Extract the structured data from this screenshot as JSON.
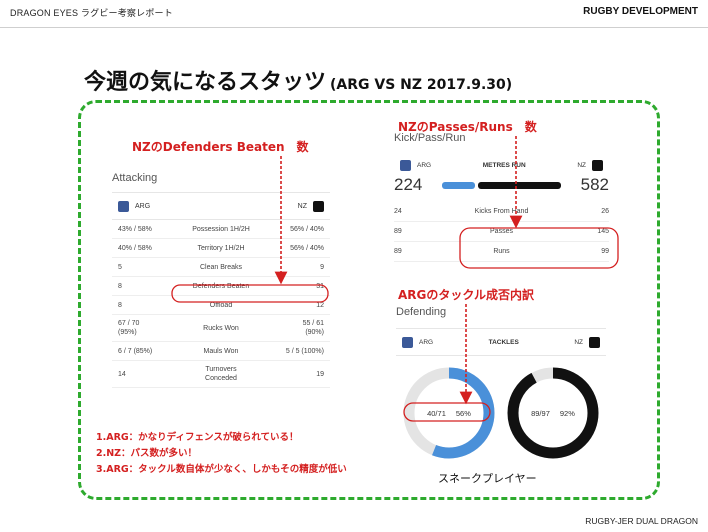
{
  "header": {
    "left": "DRAGON EYES ラグビー考察レポート",
    "right": "RUGBY DEVELOPMENT"
  },
  "footer": "RUGBY-JER DUAL DRAGON",
  "title": {
    "main": "今週の気になるスタッツ",
    "sub": "(ARG VS NZ 2017.9.30)"
  },
  "annotations": {
    "defenders_beaten": "NZのDefenders Beaten　数",
    "passes_runs": "NZのPasses/Runs　数",
    "arg_tackles": "ARGのタックル成否内訳"
  },
  "attacking": {
    "section": "Attacking",
    "team_left": "ARG",
    "team_right": "NZ",
    "rows": [
      {
        "l": "43% / 58%",
        "c": "Possession 1H/2H",
        "r": "56% / 40%"
      },
      {
        "l": "40% / 58%",
        "c": "Territory 1H/2H",
        "r": "56% / 40%"
      },
      {
        "l": "5",
        "c": "Clean Breaks",
        "r": "9"
      },
      {
        "l": "8",
        "c": "Defenders Beaten",
        "r": "31"
      },
      {
        "l": "8",
        "c": "Offload",
        "r": "12"
      },
      {
        "l": "67 / 70\n(95%)",
        "c": "Rucks Won",
        "r": "55 / 61\n(90%)"
      },
      {
        "l": "6 / 7 (85%)",
        "c": "Mauls Won",
        "r": "5 / 5 (100%)"
      },
      {
        "l": "14",
        "c": "Turnovers\nConceded",
        "r": "19"
      }
    ]
  },
  "kick_pass_run": {
    "section": "Kick/Pass/Run",
    "team_left": "ARG",
    "metric": "METRES RUN",
    "team_right": "NZ",
    "metres_left": "224",
    "metres_right": "582",
    "rows": [
      {
        "l": "24",
        "c": "Kicks From Hand",
        "r": "26"
      },
      {
        "l": "89",
        "c": "Passes",
        "r": "145"
      },
      {
        "l": "89",
        "c": "Runs",
        "r": "99"
      }
    ]
  },
  "defending": {
    "section": "Defending",
    "team_left": "ARG",
    "metric": "TACKLES",
    "team_right": "NZ",
    "arg_tackles": "40/71",
    "arg_pct": "56%",
    "arg_fraction": 0.56,
    "nz_tackles": "89/97",
    "nz_pct": "92%",
    "nz_fraction": 0.92,
    "caption": "スネークプレイヤー"
  },
  "notes": [
    "1.ARG：かなりディフェンスが破られている！",
    "2.NZ：パス数が多い！",
    "3.ARG：タックル数自体が少なく、しかもその精度が低い"
  ],
  "colors": {
    "accent_red": "#d42020",
    "frame_green": "#2eaa2e",
    "arg_blue": "#4a90d9",
    "nz_black": "#111111"
  }
}
